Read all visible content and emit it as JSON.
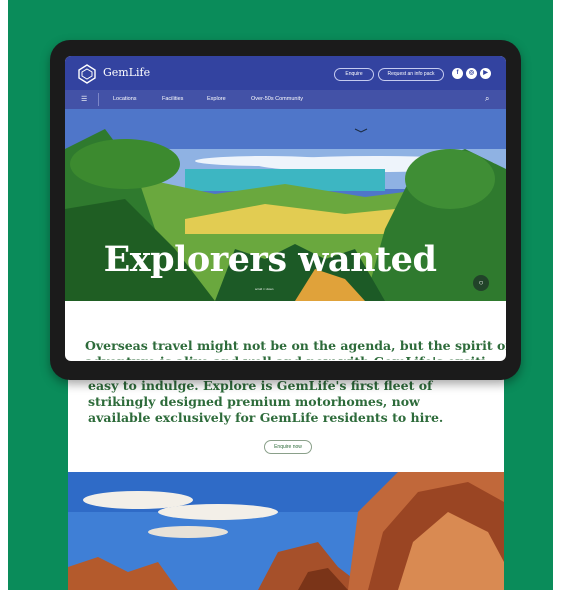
{
  "colors": {
    "background_green": "#0a8c5a",
    "brand_blue": "#3343a0",
    "text_green": "#2d6b3a"
  },
  "header": {
    "brand": "GemLife",
    "enquire_label": "Enquire",
    "info_pack_label": "Request an info pack",
    "social": [
      "f",
      "◎",
      "▶"
    ]
  },
  "nav": {
    "menu_icon": "☰",
    "items": [
      "Locations",
      "Facilities",
      "Explore",
      "Over-50s Community"
    ],
    "search_icon": "⌕"
  },
  "hero": {
    "title": "Explorers wanted",
    "scroll_label": "scroll ⬭ down"
  },
  "intro": {
    "line1": "Overseas travel might not be on the agenda, but the spirit of",
    "line2": "adventure is alive and well and now with GemLife's exciting",
    "body": "easy to indulge. Explore is GemLife's first fleet of strikingly designed premium motorhomes, now available exclusively for GemLife residents to hire.",
    "cta": "Enquire now"
  }
}
